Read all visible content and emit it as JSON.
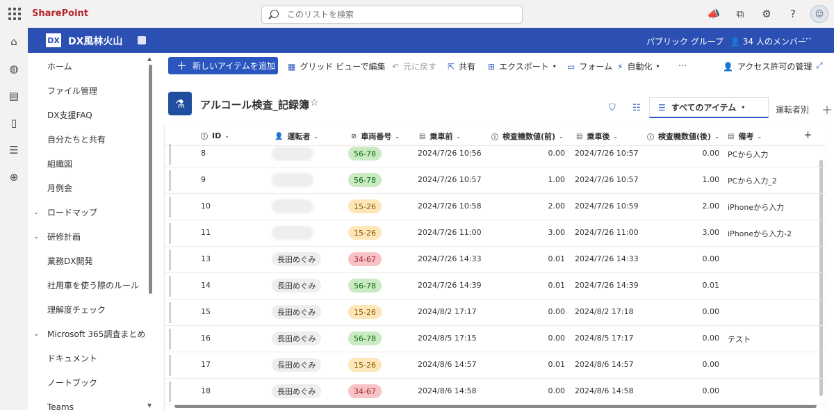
{
  "suitebar": {
    "brand": "SharePoint",
    "search_placeholder": "このリストを検索"
  },
  "site": {
    "logo_text": "DX",
    "title": "DX風林火山",
    "group_type": "パブリック グループ",
    "members": "34 人のメンバー"
  },
  "nav": {
    "items": [
      {
        "label": "ホーム",
        "chevron": false
      },
      {
        "label": "ファイル管理",
        "chevron": false
      },
      {
        "label": "DX支援FAQ",
        "chevron": false
      },
      {
        "label": "自分たちと共有",
        "chevron": false
      },
      {
        "label": "組織図",
        "chevron": false
      },
      {
        "label": "月例会",
        "chevron": false
      },
      {
        "label": "ロードマップ",
        "chevron": true
      },
      {
        "label": "研修計画",
        "chevron": true
      },
      {
        "label": "業務DX開発",
        "chevron": false
      },
      {
        "label": "社用車を使う際のルール",
        "chevron": false
      },
      {
        "label": "理解度チェック",
        "chevron": false
      },
      {
        "label": "Microsoft 365調査まとめ",
        "chevron": true
      },
      {
        "label": "ドキュメント",
        "chevron": false
      },
      {
        "label": "ノートブック",
        "chevron": false
      },
      {
        "label": "Teams",
        "chevron": false
      }
    ]
  },
  "commands": {
    "new_item": "新しいアイテムを追加",
    "grid_edit": "グリッド ビューで編集",
    "undo": "元に戻す",
    "share": "共有",
    "export": "エクスポート",
    "forms": "フォーム",
    "automate": "自動化",
    "access": "アクセス許可の管理"
  },
  "list": {
    "title": "アルコール検査_記録簿",
    "view": "すべてのアイテム",
    "view2": "運転者別"
  },
  "columns": [
    "ID",
    "運転者",
    "車両番号",
    "乗車前",
    "検査機数値(前)",
    "乗車後",
    "検査機数値(後)",
    "備考"
  ],
  "rows": [
    {
      "id": "8",
      "driver": "",
      "vehicle": "56-78",
      "before": "2024/7/26 10:56",
      "val_before": "0.00",
      "after": "2024/7/26 10:57",
      "val_after": "0.00",
      "note": "PCから入力"
    },
    {
      "id": "9",
      "driver": "",
      "vehicle": "56-78",
      "before": "2024/7/26 10:57",
      "val_before": "1.00",
      "after": "2024/7/26 10:57",
      "val_after": "1.00",
      "note": "PCから入力_2"
    },
    {
      "id": "10",
      "driver": "",
      "vehicle": "15-26",
      "before": "2024/7/26 10:58",
      "val_before": "2.00",
      "after": "2024/7/26 10:59",
      "val_after": "2.00",
      "note": "iPhoneから入力"
    },
    {
      "id": "11",
      "driver": "",
      "vehicle": "15-26",
      "before": "2024/7/26 11:00",
      "val_before": "3.00",
      "after": "2024/7/26 11:00",
      "val_after": "3.00",
      "note": "iPhoneから入力-2"
    },
    {
      "id": "13",
      "driver": "長田めぐみ",
      "vehicle": "34-67",
      "before": "2024/7/26 14:33",
      "val_before": "0.01",
      "after": "2024/7/26 14:33",
      "val_after": "0.00",
      "note": ""
    },
    {
      "id": "14",
      "driver": "長田めぐみ",
      "vehicle": "56-78",
      "before": "2024/7/26 14:39",
      "val_before": "0.01",
      "after": "2024/7/26 14:39",
      "val_after": "0.01",
      "note": ""
    },
    {
      "id": "15",
      "driver": "長田めぐみ",
      "vehicle": "15-26",
      "before": "2024/8/2 17:17",
      "val_before": "0.00",
      "after": "2024/8/2 17:18",
      "val_after": "0.00",
      "note": ""
    },
    {
      "id": "16",
      "driver": "長田めぐみ",
      "vehicle": "56-78",
      "before": "2024/8/5 17:15",
      "val_before": "0.00",
      "after": "2024/8/5 17:17",
      "val_after": "0.00",
      "note": "テスト"
    },
    {
      "id": "17",
      "driver": "長田めぐみ",
      "vehicle": "15-26",
      "before": "2024/8/6 14:57",
      "val_before": "0.01",
      "after": "2024/8/6 14:57",
      "val_after": "0.00",
      "note": ""
    },
    {
      "id": "18",
      "driver": "長田めぐみ",
      "vehicle": "34-67",
      "before": "2024/8/6 14:58",
      "val_before": "0.00",
      "after": "2024/8/6 14:58",
      "val_after": "0.00",
      "note": ""
    }
  ],
  "vehicle_colors": {
    "56-78": {
      "bg": "#caeac4",
      "fg": "#0b6a0b"
    },
    "15-26": {
      "bg": "#fde7b9",
      "fg": "#8a5a00"
    },
    "34-67": {
      "bg": "#f7c3c6",
      "fg": "#a4262c"
    }
  },
  "colors": {
    "accent": "#2b56c0",
    "site_header": "#2b4fb3",
    "brand": "#b4262d"
  }
}
